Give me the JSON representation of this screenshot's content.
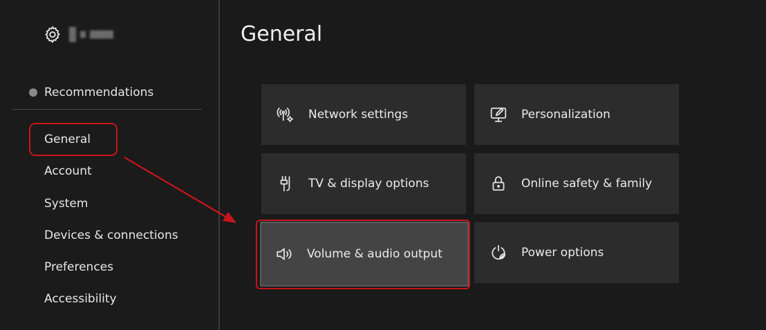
{
  "sidebar": {
    "recommendations_label": "Recommendations",
    "items": [
      {
        "label": "General"
      },
      {
        "label": "Account"
      },
      {
        "label": "System"
      },
      {
        "label": "Devices & connections"
      },
      {
        "label": "Preferences"
      },
      {
        "label": "Accessibility"
      }
    ]
  },
  "main": {
    "title": "General",
    "tiles": [
      {
        "label": "Network settings",
        "icon": "network-icon"
      },
      {
        "label": "Personalization",
        "icon": "personalization-icon"
      },
      {
        "label": "TV & display options",
        "icon": "tv-display-icon"
      },
      {
        "label": "Online safety & family",
        "icon": "lock-icon"
      },
      {
        "label": "Volume & audio output",
        "icon": "speaker-icon",
        "selected": true
      },
      {
        "label": "Power options",
        "icon": "power-icon"
      }
    ]
  },
  "colors": {
    "background": "#1a1a1a",
    "tile": "#2c2c2c",
    "tile_selected": "#444444",
    "annotation_red": "#c8151b"
  }
}
